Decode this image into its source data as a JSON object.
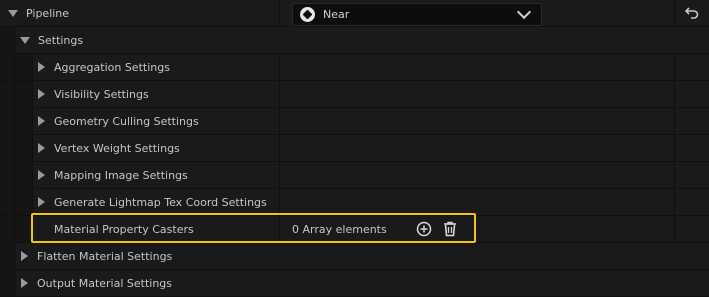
{
  "pipeline": {
    "label": "Pipeline",
    "value": "Near",
    "value_icon": "lod-cube-icon",
    "reset_icon": "reset-arrow-icon"
  },
  "settings": {
    "label": "Settings",
    "children": [
      {
        "label": "Aggregation Settings"
      },
      {
        "label": "Visibility Settings"
      },
      {
        "label": "Geometry Culling Settings"
      },
      {
        "label": "Vertex Weight Settings"
      },
      {
        "label": "Mapping Image Settings"
      },
      {
        "label": "Generate Lightmap Tex Coord Settings"
      }
    ],
    "material_casters": {
      "label": "Material Property Casters",
      "value": "0 Array elements",
      "add_icon": "add-element-icon",
      "delete_icon": "delete-icon"
    }
  },
  "flatten": {
    "label": "Flatten Material Settings"
  },
  "output": {
    "label": "Output Material Settings"
  },
  "highlight_color": "#f2c319"
}
